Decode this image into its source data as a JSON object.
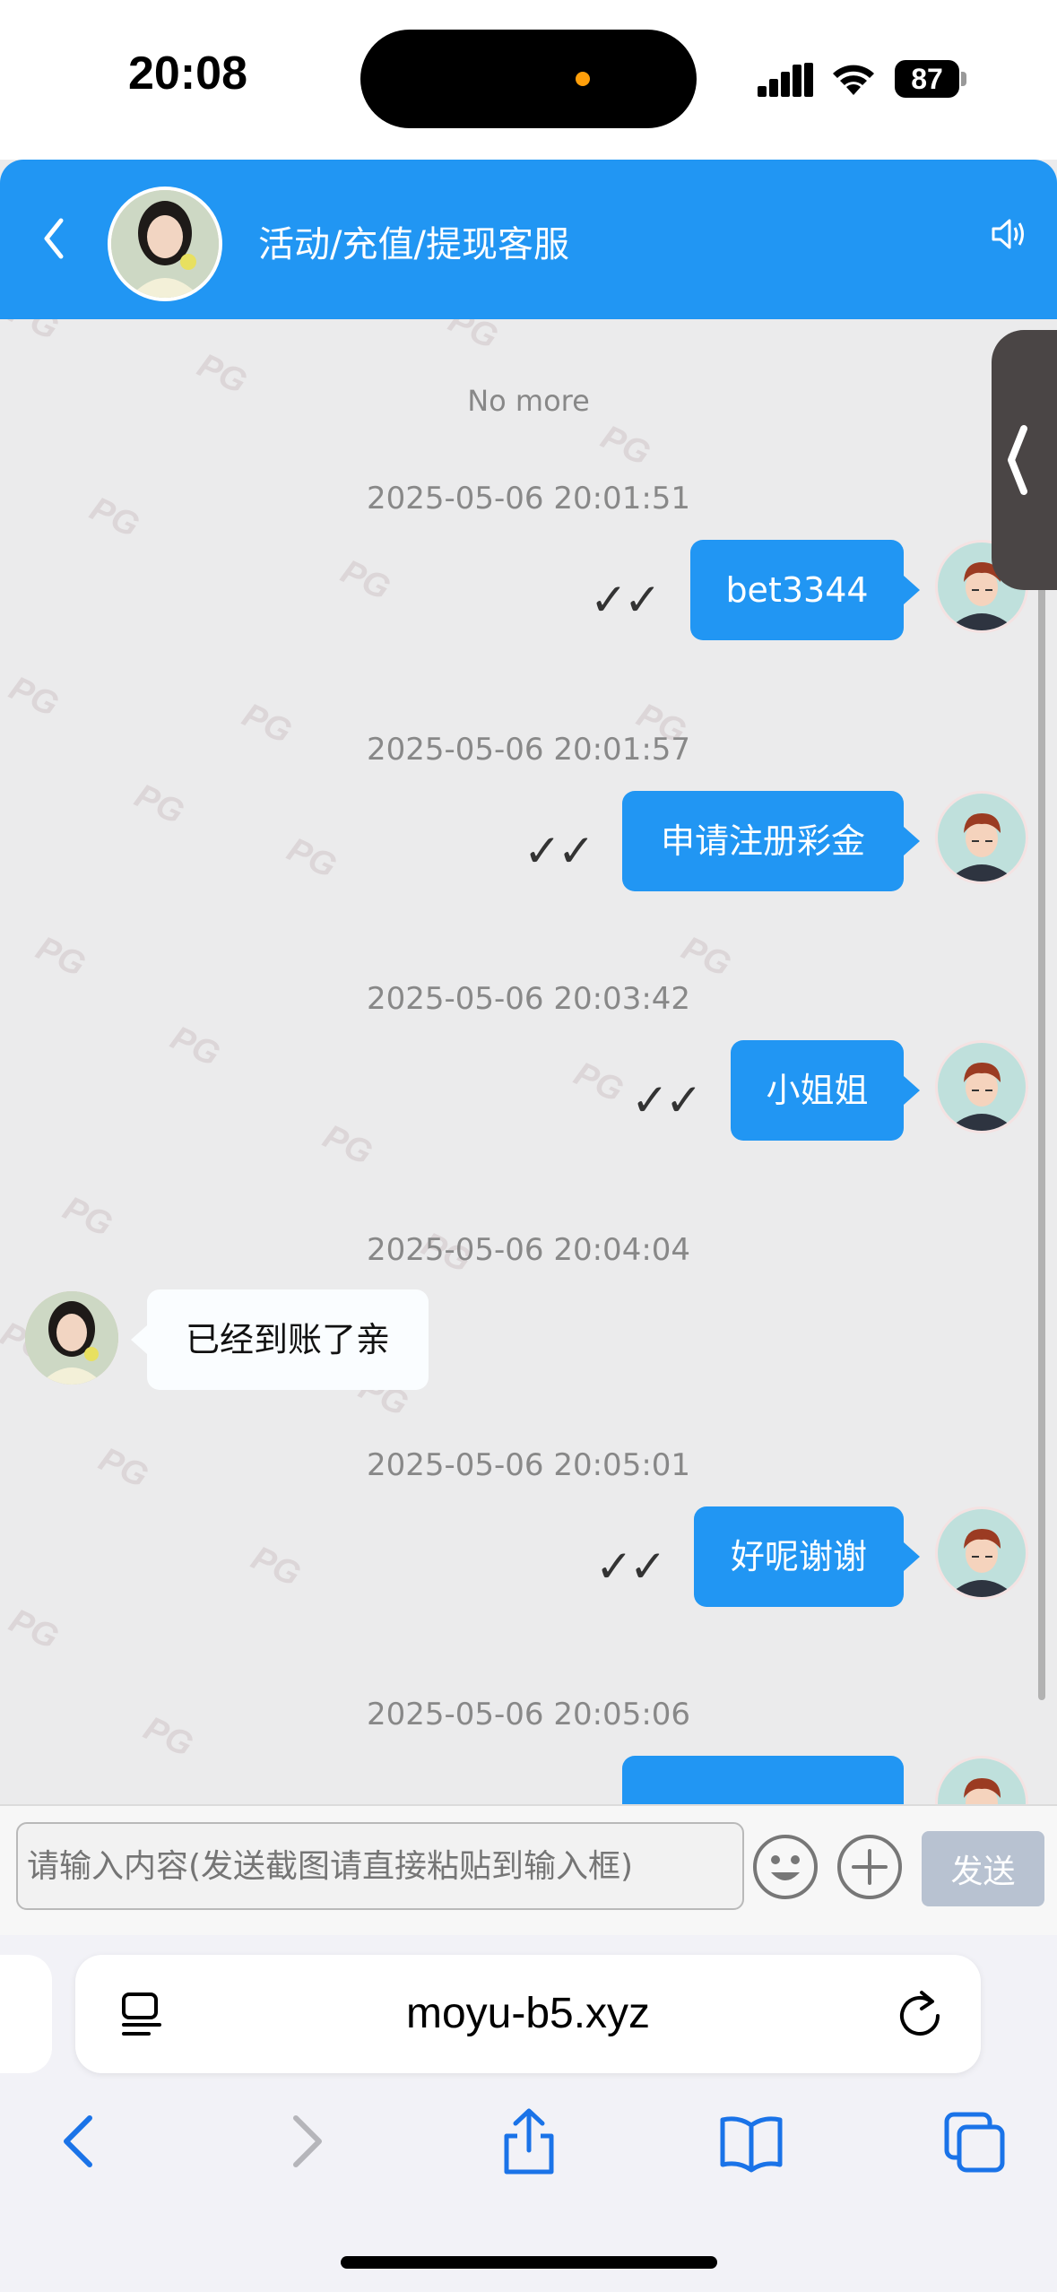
{
  "status_bar": {
    "time": "20:08",
    "battery": "87"
  },
  "header": {
    "title": "活动/充值/提现客服"
  },
  "chat": {
    "no_more": "No more",
    "watermark": "PG",
    "messages": [
      {
        "timestamp": "2025-05-06 20:01:51",
        "direction": "out",
        "text": "bet3344",
        "status": "✓✓"
      },
      {
        "timestamp": "2025-05-06 20:01:57",
        "direction": "out",
        "text": "申请注册彩金",
        "status": "✓✓"
      },
      {
        "timestamp": "2025-05-06 20:03:42",
        "direction": "out",
        "text": "小姐姐",
        "status": "✓✓"
      },
      {
        "timestamp": "2025-05-06 20:04:04",
        "direction": "in",
        "text": "已经到账了亲"
      },
      {
        "timestamp": "2025-05-06 20:05:01",
        "direction": "out",
        "text": "好呢谢谢",
        "status": "✓✓"
      },
      {
        "timestamp": "2025-05-06 20:05:06",
        "direction": "out",
        "text": ""
      }
    ]
  },
  "composer": {
    "placeholder": "请输入内容(发送截图请直接粘贴到输入框)",
    "send_label": "发送"
  },
  "browser": {
    "url": "moyu-b5.xyz"
  },
  "colors": {
    "accent": "#2196f3",
    "send_disabled": "#b8c2d1"
  }
}
